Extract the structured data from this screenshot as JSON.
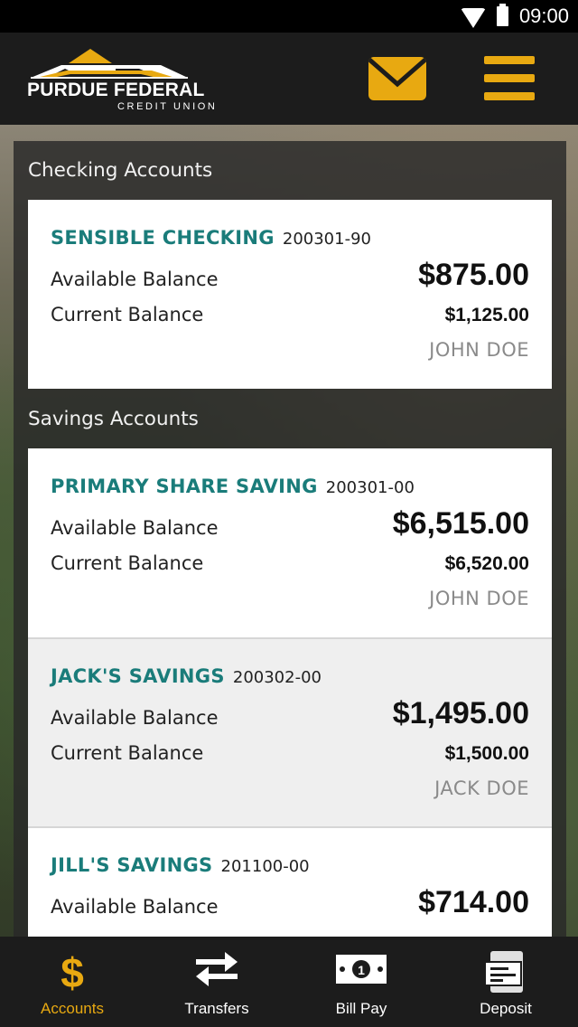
{
  "status_bar": {
    "time": "09:00",
    "icons": [
      "wifi-icon",
      "battery-icon"
    ]
  },
  "header": {
    "brand_name": "PURDUE FEDERAL",
    "brand_sub": "CREDIT UNION",
    "icons": [
      "mail-icon",
      "menu-icon"
    ],
    "accent_color": "#e8a911"
  },
  "sections": {
    "checking": {
      "title": "Checking Accounts",
      "accounts": [
        {
          "name": "SENSIBLE CHECKING",
          "number": "200301-90",
          "available_label": "Available Balance",
          "available": "$875.00",
          "current_label": "Current Balance",
          "current": "$1,125.00",
          "owner": "JOHN DOE"
        }
      ]
    },
    "savings": {
      "title": "Savings Accounts",
      "accounts": [
        {
          "name": "PRIMARY SHARE SAVING",
          "number": "200301-00",
          "available_label": "Available Balance",
          "available": "$6,515.00",
          "current_label": "Current Balance",
          "current": "$6,520.00",
          "owner": "JOHN DOE"
        },
        {
          "name": "JACK'S SAVINGS",
          "number": "200302-00",
          "available_label": "Available Balance",
          "available": "$1,495.00",
          "current_label": "Current Balance",
          "current": "$1,500.00",
          "owner": "JACK DOE"
        },
        {
          "name": "JILL'S SAVINGS",
          "number": "201100-00",
          "available_label": "Available Balance",
          "available": "$714.00"
        }
      ]
    }
  },
  "bottom_nav": {
    "items": [
      {
        "label": "Accounts",
        "icon": "dollar-icon",
        "active": true
      },
      {
        "label": "Transfers",
        "icon": "transfer-arrows-icon",
        "active": false
      },
      {
        "label": "Bill Pay",
        "icon": "bill-icon",
        "active": false
      },
      {
        "label": "Deposit",
        "icon": "check-deposit-icon",
        "active": false
      }
    ],
    "active_color": "#e8a911"
  }
}
